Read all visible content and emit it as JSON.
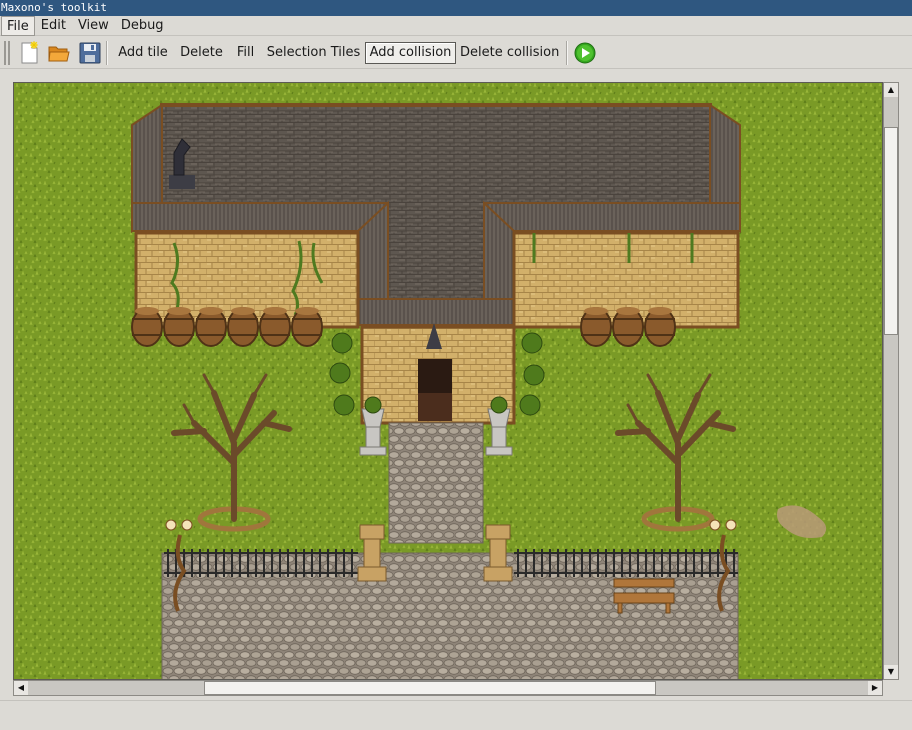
{
  "window": {
    "title": "Maxono's toolkit"
  },
  "menubar": {
    "items": [
      "File",
      "Edit",
      "View",
      "Debug"
    ]
  },
  "toolbar": {
    "icons": [
      "new-file-icon",
      "open-folder-icon",
      "save-floppy-icon"
    ],
    "buttons": [
      "Add tile",
      "Delete",
      "Fill",
      "Selection Tiles",
      "Add collision",
      "Delete collision"
    ],
    "pressed": "Add collision",
    "run_icon": "play-icon"
  },
  "colors": {
    "grass": "#7a9a26",
    "roof": "#5e5750",
    "brick": "#d2b06a",
    "cobblestone": "#a49a8c",
    "wood": "#7a4e22",
    "titlebar": "#2f5780",
    "play_green": "#34a61f"
  },
  "scroll": {
    "vertical_fraction": 0.42,
    "horizontal_fraction": 0.52
  }
}
